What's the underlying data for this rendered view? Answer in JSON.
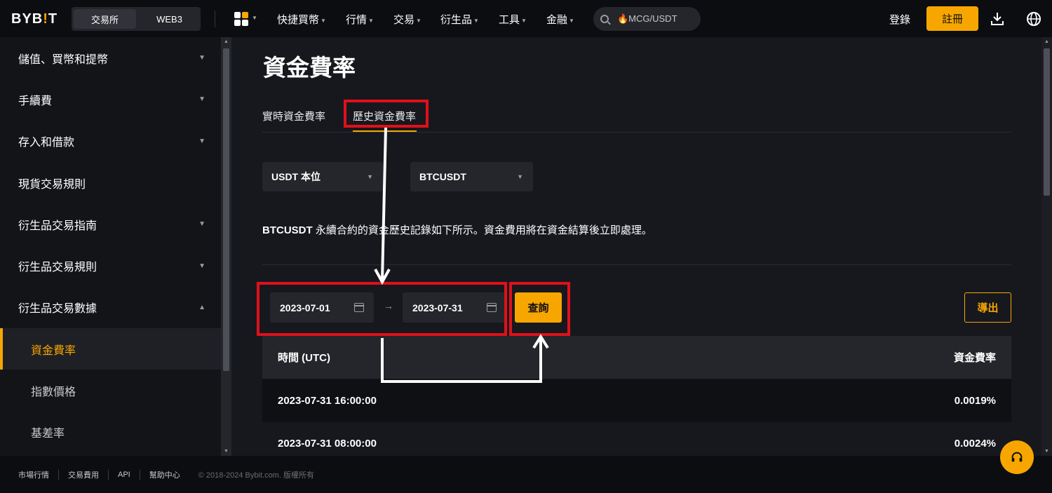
{
  "header": {
    "logo": "BYBIT",
    "segments": [
      "交易所",
      "WEB3"
    ],
    "nav": [
      "快捷買幣",
      "行情",
      "交易",
      "衍生品",
      "工具",
      "金融"
    ],
    "search_text": "🔥MCG/USDT",
    "login": "登錄",
    "register": "註冊"
  },
  "sidebar": {
    "items": [
      "儲值、買幣和提幣",
      "手續費",
      "存入和借款",
      "現貨交易規則",
      "衍生品交易指南",
      "衍生品交易規則",
      "衍生品交易數據"
    ],
    "subitems": [
      "資金費率",
      "指數價格",
      "基差率"
    ]
  },
  "main": {
    "title": "資金費率",
    "tabs": [
      "實時資金費率",
      "歷史資金費率"
    ],
    "select_type": "USDT 本位",
    "select_symbol": "BTCUSDT",
    "desc_symbol": "BTCUSDT",
    "desc_text": " 永續合約的資金歷史記錄如下所示。資金費用將在資金結算後立即處理。",
    "date_from": "2023-07-01",
    "date_to": "2023-07-31",
    "query": "查詢",
    "export": "導出",
    "table": {
      "headers": [
        "時間 (UTC)",
        "資金費率"
      ],
      "rows": [
        [
          "2023-07-31 16:00:00",
          "0.0019%"
        ],
        [
          "2023-07-31 08:00:00",
          "0.0024%"
        ]
      ]
    }
  },
  "footer": {
    "links": [
      "市場行情",
      "交易費用",
      "API",
      "幫助中心"
    ],
    "copyright": "© 2018-2024 Bybit.com. 版權所有"
  },
  "colors": {
    "accent": "#f7a600",
    "annotation": "#e0101a",
    "background": "#17181e"
  }
}
